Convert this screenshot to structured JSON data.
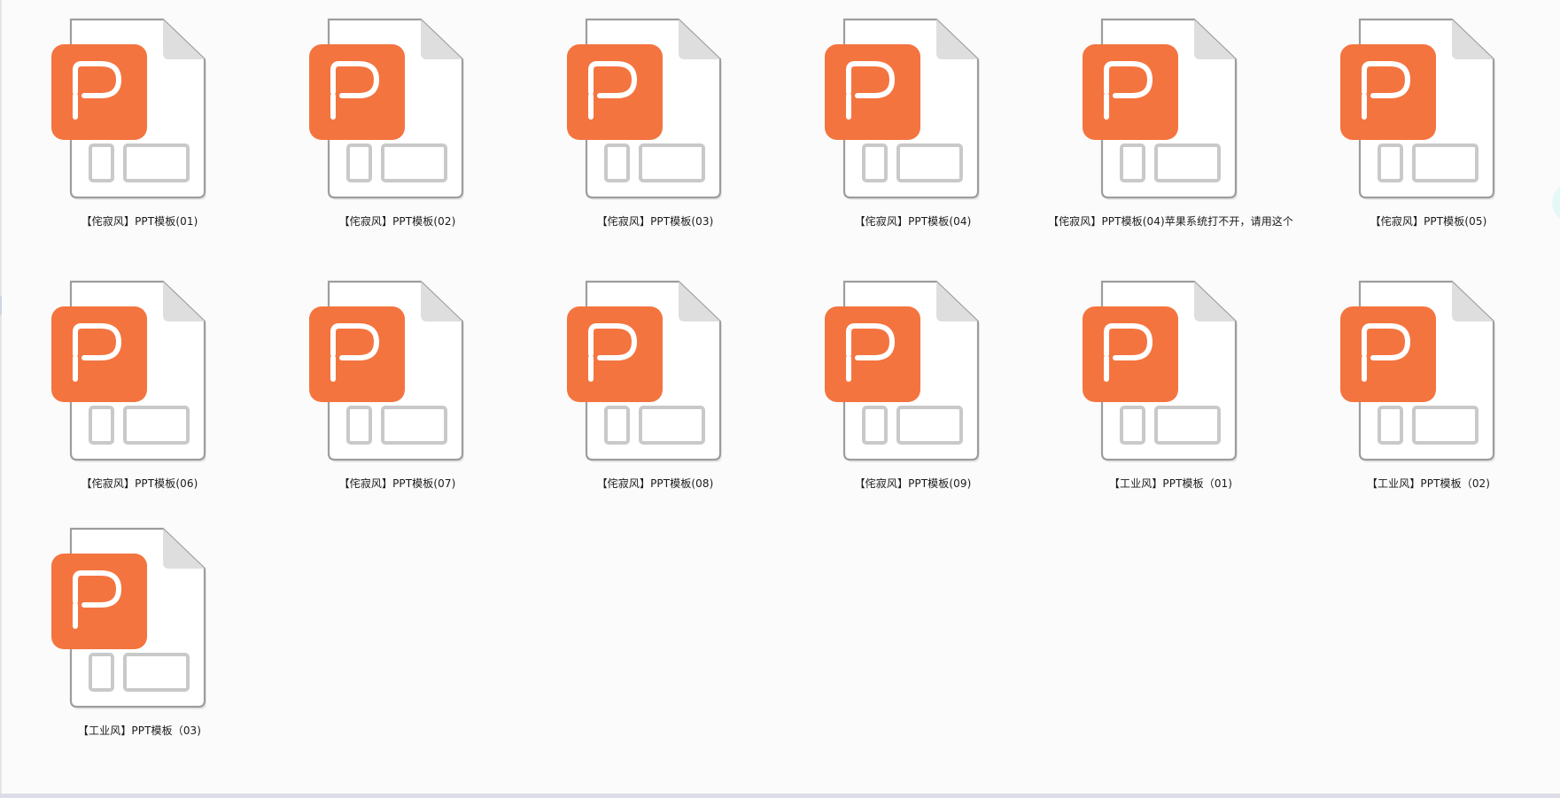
{
  "files": [
    {
      "name": "【侘寂风】PPT模板(01)",
      "icon": "ppt-file-icon"
    },
    {
      "name": "【侘寂风】PPT模板(02)",
      "icon": "ppt-file-icon"
    },
    {
      "name": "【侘寂风】PPT模板(03)",
      "icon": "ppt-file-icon"
    },
    {
      "name": "【侘寂风】PPT模板(04)",
      "icon": "ppt-file-icon"
    },
    {
      "name": "【侘寂风】PPT模板(04)苹果系统打不开，请用这个",
      "icon": "ppt-file-icon"
    },
    {
      "name": "【侘寂风】PPT模板(05)",
      "icon": "ppt-file-icon"
    },
    {
      "name": "【侘寂风】PPT模板(06)",
      "icon": "ppt-file-icon"
    },
    {
      "name": "【侘寂风】PPT模板(07)",
      "icon": "ppt-file-icon"
    },
    {
      "name": "【侘寂风】PPT模板(08)",
      "icon": "ppt-file-icon"
    },
    {
      "name": "【侘寂风】PPT模板(09)",
      "icon": "ppt-file-icon"
    },
    {
      "name": "【工业风】PPT模板（01)",
      "icon": "ppt-file-icon"
    },
    {
      "name": "【工业风】PPT模板（02)",
      "icon": "ppt-file-icon"
    },
    {
      "name": "【工业风】PPT模板（03)",
      "icon": "ppt-file-icon"
    }
  ],
  "colors": {
    "ppt_orange": "#f4743f",
    "page_white": "#ffffff",
    "page_border": "#9d9d9d",
    "fold": "#dedede",
    "placeholder": "#c9c9c9"
  }
}
